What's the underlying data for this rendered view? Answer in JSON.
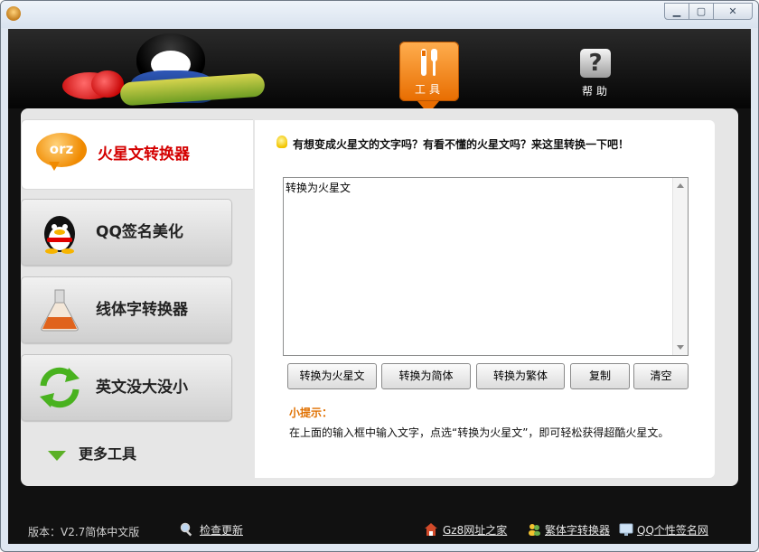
{
  "window": {
    "min_label": "▁",
    "max_label": "▢",
    "close_label": "✕"
  },
  "nav": {
    "tools_label": "工具",
    "help_label": "帮助",
    "help_glyph": "?"
  },
  "sidebar": {
    "items": [
      {
        "label": "火星文转换器",
        "icon": "orz-bubble-icon",
        "icon_text": "orz",
        "active": true
      },
      {
        "label": "QQ签名美化",
        "icon": "qq-penguin-icon",
        "active": false
      },
      {
        "label": "线体字转换器",
        "icon": "flask-icon",
        "active": false
      },
      {
        "label": "英文没大没小",
        "icon": "refresh-arrows-icon",
        "active": false
      }
    ],
    "more_label": "更多工具"
  },
  "main": {
    "top_hint": "有想变成火星文的文字吗？有看不懂的火星文吗？来这里转换一下吧！",
    "input_value": "转换为火星文",
    "buttons": {
      "to_martian": "转换为火星文",
      "to_simplified": "转换为简体",
      "to_traditional": "转换为繁体",
      "copy": "复制",
      "clear": "清空"
    },
    "tips_title": "小提示：",
    "tips_body": "在上面的输入框中输入文字，点选“转换为火星文”，即可轻松获得超酷火星文。"
  },
  "footer": {
    "version": "版本：V2.7简体中文版",
    "check_update": "检查更新",
    "links": [
      "Gz8网址之家",
      "繁体字转换器",
      "QQ个性签名网"
    ]
  },
  "colors": {
    "accent_orange": "#e86d00",
    "active_red": "#d40000",
    "tips_orange": "#e07000"
  }
}
